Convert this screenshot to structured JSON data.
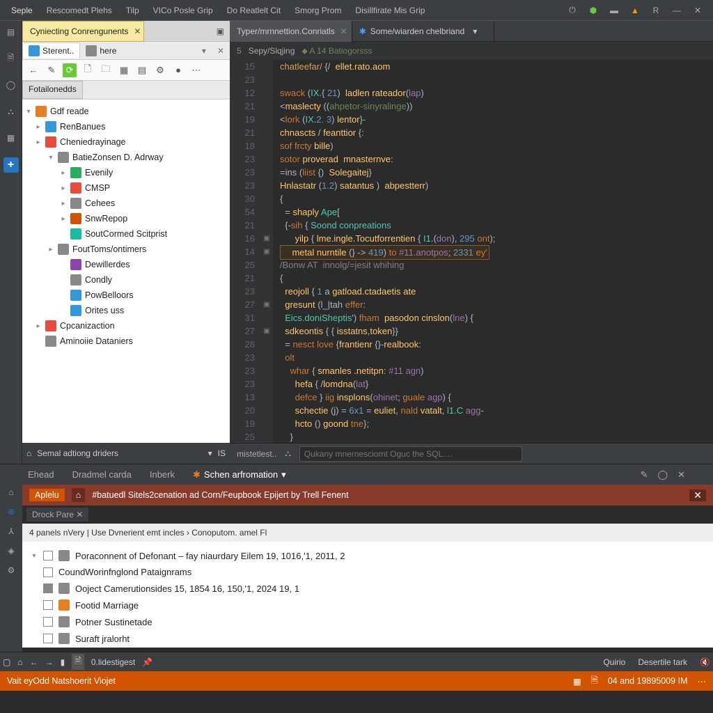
{
  "menubar": {
    "items": [
      "Seple",
      "Rescomedt Plehs",
      "Tilp",
      "VICo Posle Grip",
      "Do Reatlelt Cit",
      "Smorg Prom",
      "Disillfirate Mis Grip"
    ]
  },
  "left_panel": {
    "main_tab": "Cyniecting Conrengunents",
    "sec_tabs": [
      "Sterent..",
      "here"
    ],
    "filter_tab": "Fotailonedds",
    "tree": [
      {
        "depth": 0,
        "exp": "▾",
        "icon": "orange",
        "label": "Gdf reade"
      },
      {
        "depth": 1,
        "exp": "▸",
        "icon": "blue-b",
        "label": "RenBanues"
      },
      {
        "depth": 1,
        "exp": "▸",
        "icon": "red-b",
        "label": "Cheniedrayinage"
      },
      {
        "depth": 2,
        "exp": "▾",
        "icon": "grey-b",
        "label": "BatieZonsen D. Adrway"
      },
      {
        "depth": 3,
        "exp": "▸",
        "icon": "green-b",
        "label": "Evenily"
      },
      {
        "depth": 3,
        "exp": "▸",
        "icon": "red-b",
        "label": "CMSP"
      },
      {
        "depth": 3,
        "exp": "▸",
        "icon": "grey-b",
        "label": "Cehees"
      },
      {
        "depth": 3,
        "exp": "▸",
        "icon": "folder",
        "label": "SnwRepop"
      },
      {
        "depth": 3,
        "exp": "",
        "icon": "teal-b",
        "label": "SoutCormed Scitprist"
      },
      {
        "depth": 2,
        "exp": "▸",
        "icon": "grey-b",
        "label": "FoutToms/ontimers"
      },
      {
        "depth": 3,
        "exp": "",
        "icon": "purple-b",
        "label": "Dewillerdes"
      },
      {
        "depth": 3,
        "exp": "",
        "icon": "grey-b",
        "label": "Condly"
      },
      {
        "depth": 3,
        "exp": "",
        "icon": "blue-b",
        "label": "PowBelloors"
      },
      {
        "depth": 3,
        "exp": "",
        "icon": "blue-b",
        "label": "Orites uss"
      },
      {
        "depth": 1,
        "exp": "▸",
        "icon": "red-b",
        "label": "Cpcanizaction"
      },
      {
        "depth": 1,
        "exp": "",
        "icon": "grey-b",
        "label": "Aminoiie Dataniers"
      }
    ],
    "search_label": "Semal adtiong driders",
    "search_suffix": "IS"
  },
  "editor": {
    "tabs": [
      {
        "label": "Typer/mrnnettion.Conriatls",
        "active": true
      },
      {
        "label": "Some/wiarden chelbriand",
        "active": false,
        "star": true
      }
    ],
    "breadcrumb_a": "5",
    "breadcrumb_b": "Sepy/Slqjing",
    "breadcrumb_c": "A 14 Batiogorsss",
    "gutter": [
      "15",
      "23",
      "12",
      "21",
      "19",
      "21",
      "18",
      "23",
      "23",
      "23",
      "30",
      "54",
      "21",
      "16",
      "14",
      "25",
      "21",
      "23",
      "27",
      "31",
      "27",
      "28",
      "23",
      "23",
      "23",
      "13",
      "20",
      "19",
      "25"
    ],
    "marks": [
      "",
      "",
      "",
      "",
      "",
      "",
      "",
      "",
      "",
      "",
      "",
      "",
      "",
      "▣",
      "▣",
      "",
      "",
      "",
      "▣",
      "",
      "▣",
      "",
      "",
      "",
      "",
      "",
      "",
      "",
      ""
    ],
    "lines": [
      "<span class='pu'>chatleefar/</span> <span class='op'>{/</span>  <span class='fn'>ellet.rato.aom</span>",
      "",
      "<span class='kw'>swack</span> (<span class='ty'>IX</span>.{ <span class='num'>21</span>)  <span class='fn'>ladlen rateador</span>(<span class='lit'>lap</span>)",
      "<span class='op'>&lt;</span><span class='fn'>maslecty</span> <span class='op'>((</span><span class='str'>ahpetor-sinyralinge</span><span class='op'>)</span>)",
      "<span class='op'>&lt;</span><span class='kw'>lork</span> (<span class='ty'>IX</span>.<span class='num'>2. 3</span>) <span class='fn'>lentor</span>}-",
      "<span class='fn'>chnascts</span> / <span class='fn'>feanttior</span> {:",
      "<span class='kw'>sof</span> <span class='kw'>frcty</span> <span class='fn'>bille</span>)",
      "<span class='kw'>sotor</span> <span class='fn'>proverad</span>  <span class='fn'>mnasternve</span>:",
      "<span class='op'>=ins</span> (<span class='kw'>liist</span> {)  <span class='fn'>Solegaitej</span>}",
      "<span class='fn'>Hnlastatr</span> (<span class='num'>1.2</span>) <span class='fn'>satantus</span> )  <span class='fn'>abpestterr</span>)",
      "{",
      "  = <span class='fn'>shaply</span> <span class='ty'>Ape</span>[",
      "  {-<span class='kw'>sih</span> { <span class='ty'>Soond conpreations</span>",
      "      <span class='fn'>yilp</span> { <span class='fn'>lme.ingle.Tocutforrentien</span> { <span class='ty'>I1</span>.(<span class='lit'>don</span>), <span class='num'>295</span> <span class='kw'>ont</span>);",
      "<span class='hl-line'>    <span class='fn'>metal nurntile</span> (<span class='op'>} -&gt; </span><span class='num'>419</span>) <span class='kw'>to</span> <span class='lit'>#11.anotpos</span>; <span class='num'>2331</span> <span class='kw'>ey'</span></span>",
      "<span class='cm'>/Bonw AT  innolg/=jesit whihing</span>",
      "{",
      "  <span class='fn'>reojoll</span> { <span class='num'>1</span> a <span class='fn'>gatload.ctadaetis ate</span>",
      "  <span class='fn'>gresunt</span> (<span class='op'>l_|tah</span> <span class='kw'>effer</span>:",
      "  <span class='ty'>Eics.doniSheptis</span>') <span class='kw'>fham</span>  <span class='fn'>pasodon cinslon</span>(<span class='lit'>lne</span>) {",
      "  <span class='fn'>sdkeontis</span> { { <span class='fn'>isstatns</span>,<span class='fn'>token</span>}}",
      "  = <span class='kw'>nesct</span> <span class='kw'>love</span> {<span class='fn'>frantienr</span> {}-<span class='fn'>realbook</span>:",
      "  <span class='kw'>olt</span>",
      "    <span class='kw'>whar</span> { <span class='fn'>smanles .netitpn</span>: <span class='lit'>#11 agn</span>)",
      "      <span class='fn'>hefa</span> { /<span class='fn'>lomdna</span>(<span class='lit'>lat</span>}",
      "      <span class='kw'>defce</span> } <span class='kw'>iig</span> <span class='fn'>insplons</span>(<span class='lit'>ohinet</span>; <span class='kw'>guale</span> <span class='lit'>agp</span>) {",
      "      <span class='fn'>schectie</span> (<span class='op'>j</span>) = <span class='num'>6x1</span> = <span class='fn'>euliet</span>, <span class='kw'>nald</span> <span class='fn'>vatalt</span>, <span class='ty'>l1.C</span> <span class='lit'>agg</span>-",
      "      <span class='fn'>hcto</span> () <span class='fn'>goond</span> <span class='kw'>tne</span>};",
      "    }"
    ],
    "run_label": "mistetlest..",
    "run_placeholder": "Qukany mnernesciomt Oguc the SQL...."
  },
  "bottom": {
    "tabs": [
      "Ehead",
      "Dradmel carda",
      "Inberk",
      "Schen arfromation"
    ],
    "alert_badge": "Aplelu",
    "alert_text": "#batuedl Sitels2cenation ad Corn/Feupbook Epijert by Trell Fenent",
    "dark_tab": "Drock Pare",
    "breadcrumb": "4 panels nVery | Use Dvnerient emt incles › Conoputom. amel Fl",
    "tasks": [
      {
        "exp": "▾",
        "chk": false,
        "icon": "grey-b",
        "label": "Poraconnent of Defonant – fay niaurdary Eilem 19, 1016,'1, 2011, 2"
      },
      {
        "exp": "",
        "chk": false,
        "icon": "",
        "label": "CoundWorinfnglond Pataignrams"
      },
      {
        "exp": "",
        "chk": true,
        "icon": "grey-b",
        "label": "Ooject Camerutionsides 15, 1854 16, 150,'1, 2024 19, 1"
      },
      {
        "exp": "",
        "chk": false,
        "icon": "orange",
        "label": "Footid Marriage"
      },
      {
        "exp": "",
        "chk": false,
        "icon": "grey-b",
        "label": "Potner Sustinetade"
      },
      {
        "exp": "",
        "chk": false,
        "icon": "grey-b",
        "label": "Suraft jralorht"
      }
    ]
  },
  "status1": {
    "label": "0.lidestigest",
    "right_a": "Quirio",
    "right_b": "Desertile tark"
  },
  "status2": {
    "label": "Vait eyOdd Natshoerit Viojet",
    "time": "04 and 19895009 IM"
  }
}
